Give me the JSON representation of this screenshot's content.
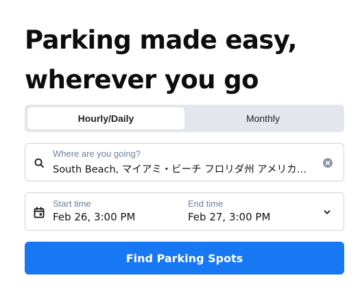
{
  "hero": {
    "headline_line1": "Parking made easy,",
    "headline_line2": "wherever you go"
  },
  "tabs": [
    {
      "label": "Hourly/Daily",
      "active": true
    },
    {
      "label": "Monthly",
      "active": false
    }
  ],
  "search": {
    "label": "Where are you going?",
    "value": "South Beach, マイアミ・ビーチ フロリダ州 アメリカ合衆国",
    "icon": "search-icon",
    "clear_icon": "clear-icon"
  },
  "dates": {
    "icon": "calendar-icon",
    "start_label": "Start time",
    "start_value": "Feb 26, 3:00 PM",
    "end_label": "End time",
    "end_value": "Feb 27, 3:00 PM",
    "toggle_icon": "chevron-down-icon"
  },
  "cta": {
    "label": "Find Parking Spots"
  },
  "colors": {
    "accent": "#1877f2",
    "tab_background": "#e3e6ec",
    "label_text": "#6b7d99",
    "border": "#cfd3da"
  }
}
